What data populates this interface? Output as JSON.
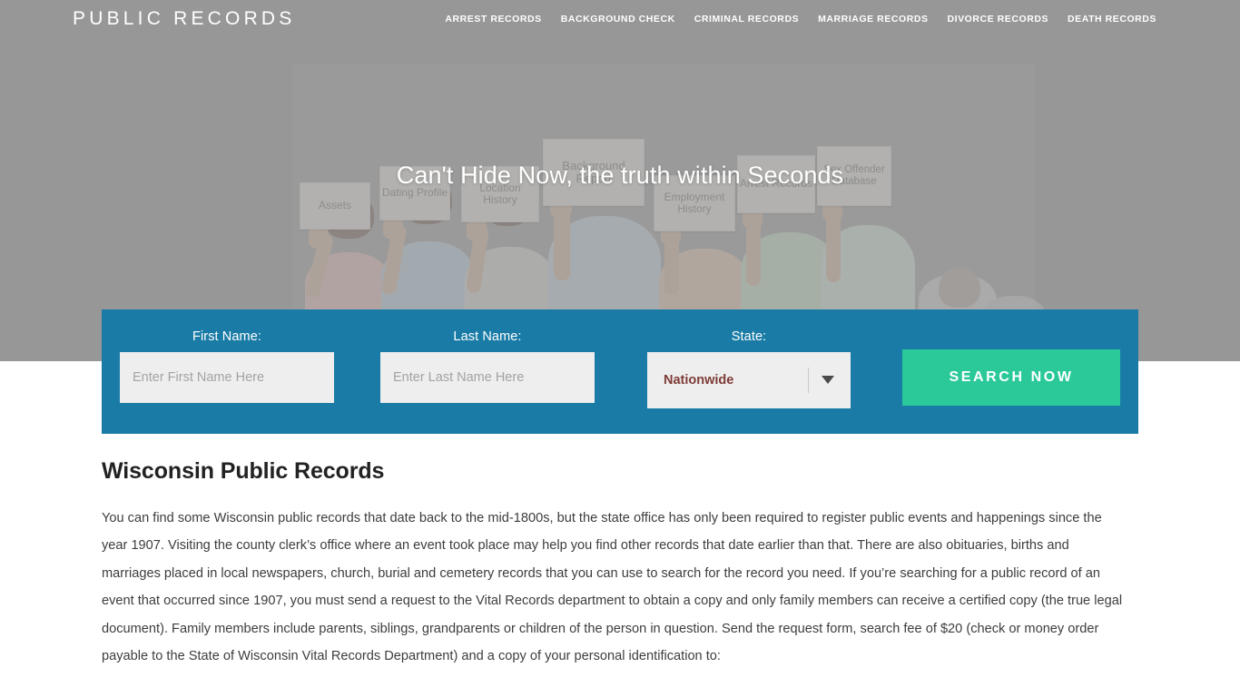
{
  "header": {
    "logo": "PUBLIC RECORDS",
    "nav": [
      {
        "label": "ARREST RECORDS"
      },
      {
        "label": "BACKGROUND CHECK"
      },
      {
        "label": "CRIMINAL RECORDS"
      },
      {
        "label": "MARRIAGE RECORDS"
      },
      {
        "label": "DIVORCE RECORDS"
      },
      {
        "label": "DEATH RECORDS"
      }
    ]
  },
  "hero": {
    "title": "Can't Hide Now, the truth within Seconds",
    "photo_signs": [
      "Assets",
      "Dating Profile",
      "Location History",
      "Background Report",
      "Employment History",
      "Arrest Records",
      "Sex Offender Database"
    ]
  },
  "search_form": {
    "first_name": {
      "label": "First Name:",
      "placeholder": "Enter First Name Here",
      "value": ""
    },
    "last_name": {
      "label": "Last Name:",
      "placeholder": "Enter Last Name Here",
      "value": ""
    },
    "state": {
      "label": "State:",
      "selected": "Nationwide"
    },
    "submit_label": "SEARCH NOW"
  },
  "main": {
    "heading": "Wisconsin Public Records",
    "paragraph": "You can find some Wisconsin public records that date back to the mid-1800s, but the state office has only been required to register public events and happenings since the year 1907. Visiting the county clerk’s office where an event took place may help you find other records that date earlier than that. There are also obituaries, births and marriages placed in local newspapers, church, burial and cemetery records that you can use to search for the record you need. If you’re searching for a public record of an event that occurred since 1907, you must send a request to the Vital Records department to obtain a copy and only family members can receive a certified copy (the true legal document). Family members include parents, siblings, grandparents or children of the person in question. Send the request form, search fee of $20 (check or money order payable to the State of Wisconsin Vital Records Department) and a copy of your personal identification to:"
  },
  "colors": {
    "header_bg": "#979797",
    "form_bg": "#1a7ca6",
    "button_bg": "#2bc99a",
    "select_text": "#7d3b36"
  }
}
